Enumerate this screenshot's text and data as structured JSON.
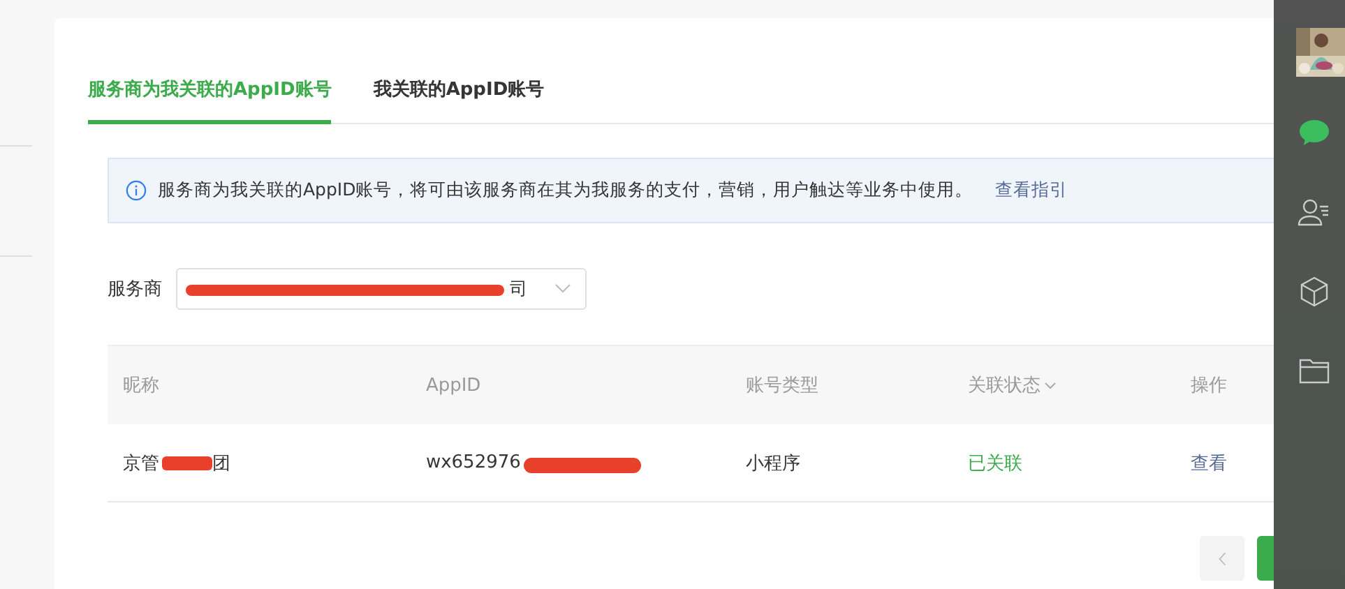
{
  "tabs": [
    {
      "label": "服务商为我关联的AppID账号",
      "selected": true
    },
    {
      "label": "我关联的AppID账号",
      "selected": false
    }
  ],
  "notice": {
    "text": "服务商为我关联的AppID账号，将可由该服务商在其为我服务的支付，营销，用户触达等业务中使用。",
    "link": "查看指引"
  },
  "filter": {
    "label": "服务商",
    "value_visible": "司"
  },
  "table": {
    "columns": [
      {
        "label": "昵称",
        "sortable": false
      },
      {
        "label": "AppID",
        "sortable": false
      },
      {
        "label": "账号类型",
        "sortable": false
      },
      {
        "label": "关联状态",
        "sortable": true
      },
      {
        "label": "操作",
        "sortable": false
      }
    ],
    "rows": [
      {
        "nickname_start": "京管",
        "nickname_end": "团",
        "appid_visible": "wx652976",
        "type": "小程序",
        "status": "已关联",
        "status_linked": true,
        "action": "查看"
      }
    ]
  },
  "side_nav": [
    {
      "kind": "chat",
      "selected": true
    },
    {
      "kind": "contacts",
      "selected": false
    },
    {
      "kind": "box",
      "selected": false
    },
    {
      "kind": "folder",
      "selected": false
    }
  ]
}
